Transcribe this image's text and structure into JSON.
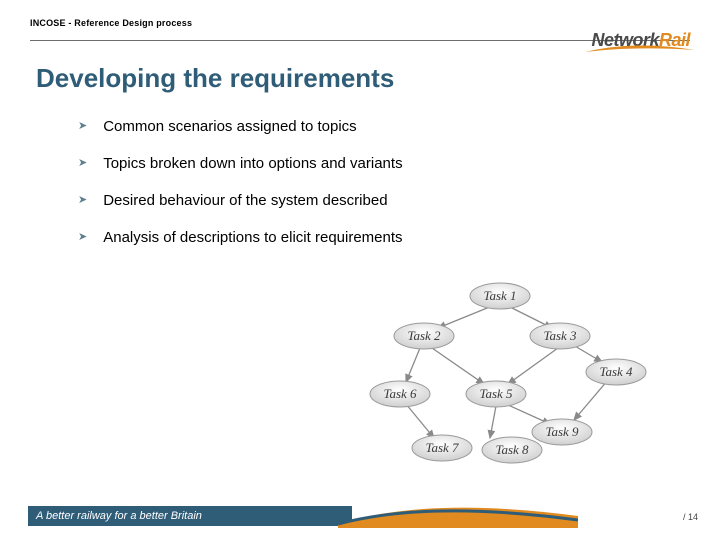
{
  "header": {
    "breadcrumb": "INCOSE - Reference Design process"
  },
  "logo": {
    "part1": "Network",
    "part2": "Rail"
  },
  "title": "Developing the requirements",
  "bullets": [
    "Common scenarios assigned to topics",
    "Topics broken down into options and variants",
    "Desired behaviour of the system described",
    "Analysis of descriptions to elicit requirements"
  ],
  "diagram": {
    "nodes": [
      {
        "id": "t1",
        "label": "Task 1"
      },
      {
        "id": "t2",
        "label": "Task 2"
      },
      {
        "id": "t3",
        "label": "Task 3"
      },
      {
        "id": "t4",
        "label": "Task 4"
      },
      {
        "id": "t5",
        "label": "Task 5"
      },
      {
        "id": "t6",
        "label": "Task 6"
      },
      {
        "id": "t7",
        "label": "Task 7"
      },
      {
        "id": "t8",
        "label": "Task 8"
      },
      {
        "id": "t9",
        "label": "Task 9"
      }
    ]
  },
  "footer": {
    "tagline": "A better railway for a better Britain"
  },
  "page": {
    "sep": "/",
    "total": "14"
  }
}
